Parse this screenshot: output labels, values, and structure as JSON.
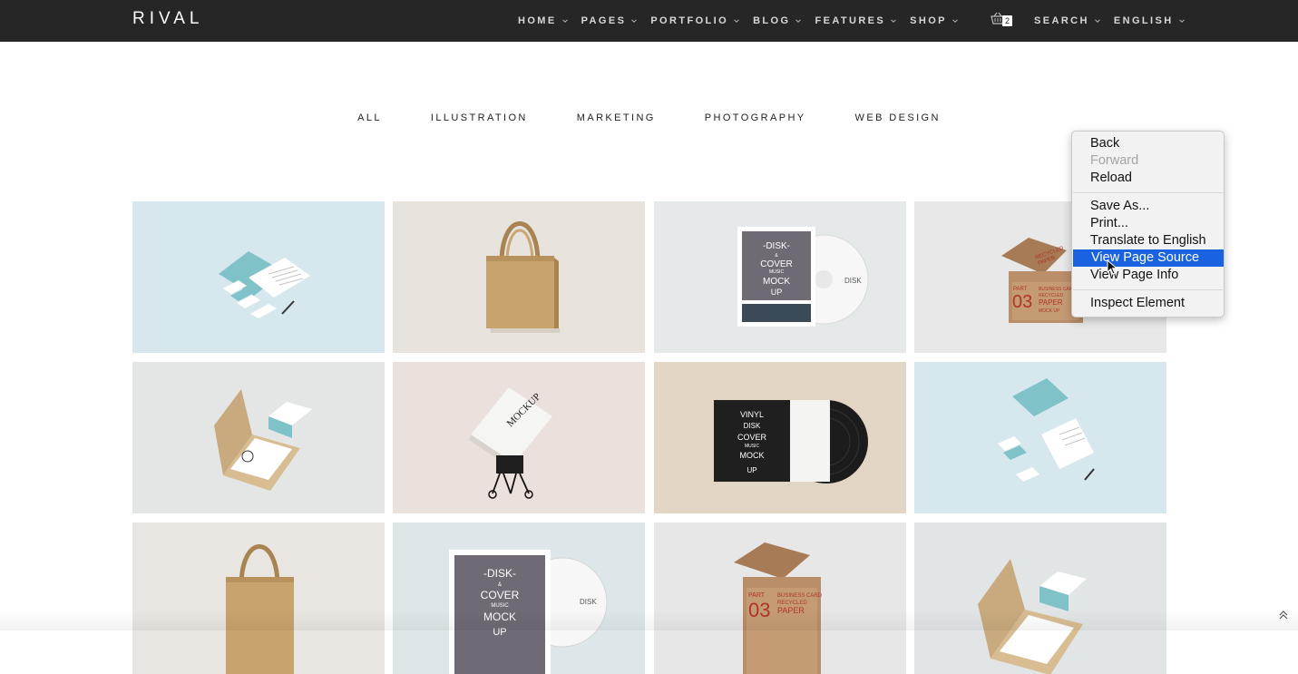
{
  "brand": "RIVAL",
  "nav": {
    "items": [
      {
        "label": "HOME"
      },
      {
        "label": "PAGES"
      },
      {
        "label": "PORTFOLIO"
      },
      {
        "label": "BLOG"
      },
      {
        "label": "FEATURES"
      },
      {
        "label": "SHOP"
      }
    ],
    "cart_count": "2",
    "search_label": "SEARCH",
    "language_label": "ENGLISH"
  },
  "filters": [
    "ALL",
    "ILLUSTRATION",
    "MARKETING",
    "PHOTOGRAPHY",
    "WEB DESIGN"
  ],
  "portfolio": {
    "tiles": [
      {
        "name": "stationery-mockup",
        "bg": "#d6e8ee"
      },
      {
        "name": "tote-bag-mockup",
        "bg": "#e8e3dd"
      },
      {
        "name": "disk-cover-mockup",
        "bg": "#e6e9e9"
      },
      {
        "name": "paper-box-mockup",
        "bg": "#e8e8e8"
      },
      {
        "name": "business-card-box-mockup",
        "bg": "#e4e6e6"
      },
      {
        "name": "book-clip-mockup",
        "bg": "#eae0dc"
      },
      {
        "name": "vinyl-cover-mockup",
        "bg": "#e2d5c3"
      },
      {
        "name": "stationery-mockup-blue",
        "bg": "#d6e8ee"
      },
      {
        "name": "tote-bag-mockup",
        "bg": "#e9e5e1"
      },
      {
        "name": "disk-cover-mockup",
        "bg": "#dde7e9"
      },
      {
        "name": "paper-box-mockup",
        "bg": "#e7e7e7"
      },
      {
        "name": "business-card-box-mockup",
        "bg": "#e2e5e5"
      }
    ],
    "tile_texts": {
      "disk": [
        "-DISK-",
        "&",
        "COVER",
        "MUSIC",
        "MOCK",
        "UP"
      ],
      "disk_label": "DISK",
      "vinyl": [
        "VINYL",
        "DISK",
        "COVER",
        "MUSIC",
        "MOCK",
        "UP"
      ],
      "paper": [
        "RECYCLED",
        "PAPER",
        "PART",
        "03",
        "BUSINESS CARD",
        "RECYCLED",
        "PAPER",
        "MOCK UP"
      ],
      "book": "MOCKUP"
    }
  },
  "context_menu": {
    "items": [
      {
        "label": "Back",
        "state": "normal"
      },
      {
        "label": "Forward",
        "state": "disabled"
      },
      {
        "label": "Reload",
        "state": "normal"
      },
      {
        "label": "Save As...",
        "state": "normal"
      },
      {
        "label": "Print...",
        "state": "normal"
      },
      {
        "label": "Translate to English",
        "state": "normal"
      },
      {
        "label": "View Page Source",
        "state": "active"
      },
      {
        "label": "View Page Info",
        "state": "normal"
      },
      {
        "label": "Inspect Element",
        "state": "normal"
      }
    ]
  },
  "icons": {
    "cart": "shopping-basket-icon",
    "chevron": "chevron-down-icon",
    "scroll_top": "double-chevron-up-icon",
    "cursor": "mouse-pointer-icon"
  },
  "colors": {
    "topbar": "#262626",
    "nav_text": "#d8d8d8",
    "menu_highlight": "#1a63e0"
  }
}
